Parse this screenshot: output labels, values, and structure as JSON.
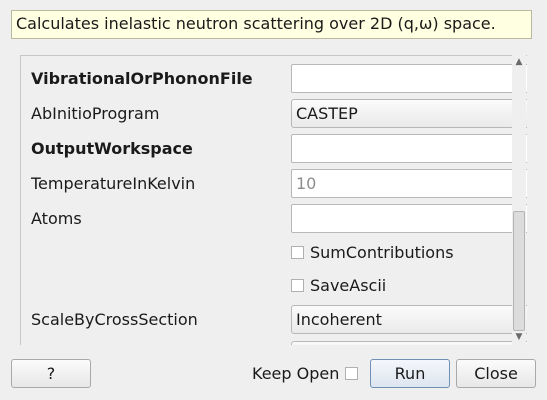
{
  "description": "Calculates inelastic neutron scattering over 2D (q,ω) space.",
  "properties": [
    {
      "label": "VibrationalOrPhononFile",
      "value": ""
    },
    {
      "label": "AbInitioProgram",
      "value": "CASTEP"
    },
    {
      "label": "OutputWorkspace",
      "value": ""
    },
    {
      "label": "TemperatureInKelvin",
      "placeholder": "10"
    },
    {
      "label": "Atoms",
      "value": ""
    },
    {
      "label": "ScaleByCrossSection",
      "value": "Incoherent"
    }
  ],
  "checkboxes": {
    "sum_contributions": {
      "label": "SumContributions",
      "checked": false
    },
    "save_ascii": {
      "label": "SaveAscii",
      "checked": false
    }
  },
  "buttons": {
    "help": "?",
    "keep_open": "Keep Open",
    "keep_open_checked": false,
    "run": "Run",
    "close": "Close"
  },
  "icons": {
    "scroll_up": "chevron-up-icon",
    "scroll_down": "chevron-down-icon"
  },
  "colors": {
    "description_bg": "#ffffe1",
    "default_button_border": "#6f8fb5"
  }
}
